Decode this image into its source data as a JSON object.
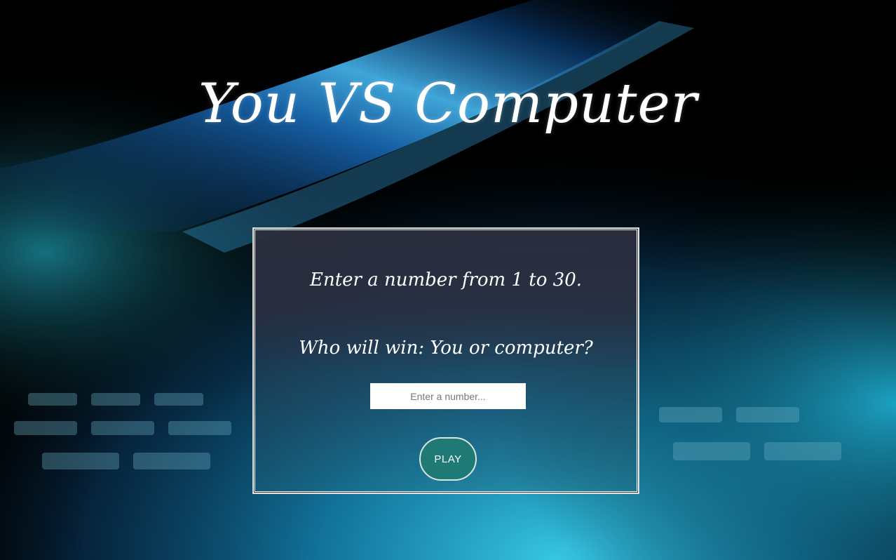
{
  "header": {
    "title": "You VS Computer"
  },
  "game": {
    "instruction": "Enter a number from 1 to 30.",
    "question": "Who will win: You or computer?",
    "input": {
      "value": "",
      "placeholder": "Enter a number..."
    },
    "play_label": "PLAY"
  },
  "colors": {
    "play_button": "#1f7a76",
    "card_background": "#2c2e3e",
    "text": "#ffffff"
  }
}
